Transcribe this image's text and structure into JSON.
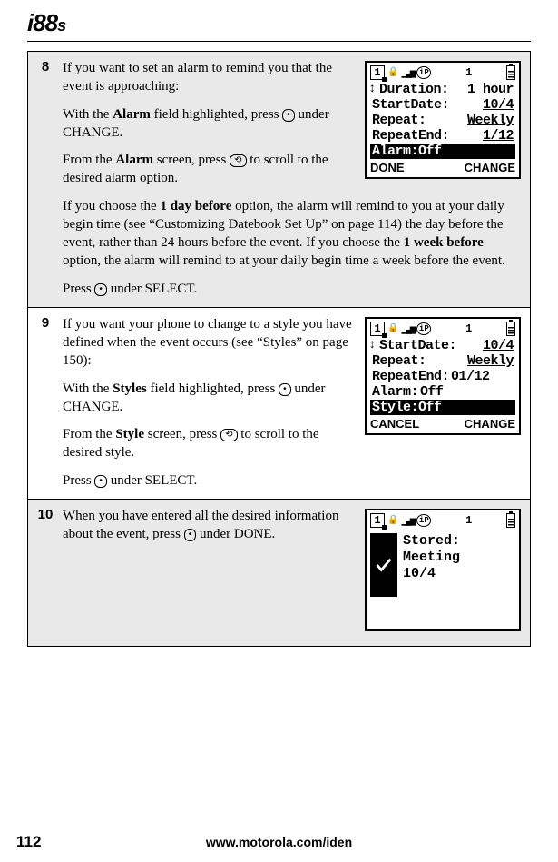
{
  "brand": "i88",
  "brand_suffix": "s",
  "footer_url": "www.motorola.com/iden",
  "page_number": "112",
  "steps": {
    "s8": {
      "num": "8",
      "p1": "If you want to set an alarm to remind you that the event is approaching:",
      "p2a": "With the ",
      "p2b": "Alarm",
      "p2c": " field highlighted, press ",
      "p2d": " under CHANGE.",
      "p3a": "From the ",
      "p3b": "Alarm",
      "p3c": " screen, press ",
      "p3d": " to scroll to the desired alarm option.",
      "p4a": "If you choose the ",
      "p4b": "1 day before",
      "p4c": " option, the alarm will remind to you at your daily begin time (see “Customizing Datebook Set Up” on page 114) the day before the event, rather than 24 hours before the event. If you choose the ",
      "p4d": "1 week before",
      "p4e": " option, the alarm will remind to at your daily begin time a week before the event.",
      "p5a": "Press ",
      "p5b": " under SELECT.",
      "screen": {
        "l1a": "Duration:",
        "l1b": "1 hour",
        "l2a": "StartDate:",
        "l2b": "10/4",
        "l3a": "Repeat:",
        "l3b": "Weekly",
        "l4a": "RepeatEnd:",
        "l4b": "1/12",
        "l5": "Alarm:Off",
        "sk_left": "DONE",
        "sk_right": "CHANGE"
      }
    },
    "s9": {
      "num": "9",
      "p1": "If you want your phone to change to a style you have defined when the event occurs (see “Styles” on page 150):",
      "p2a": "With the ",
      "p2b": "Styles",
      "p2c": " field highlighted, press ",
      "p2d": " under CHANGE.",
      "p3a": "From the ",
      "p3b": "Style",
      "p3c": " screen, press ",
      "p3d": " to scroll to the desired style.",
      "p4a": "Press ",
      "p4b": " under SELECT.",
      "screen": {
        "l1a": "StartDate:",
        "l1b": "10/4",
        "l2a": "Repeat:",
        "l2b": "Weekly",
        "l3a": "RepeatEnd:",
        "l3b": "01/12",
        "l4a": "Alarm:",
        "l4b": "Off",
        "l5": "Style:Off",
        "sk_left": "CANCEL",
        "sk_right": "CHANGE"
      }
    },
    "s10": {
      "num": "10",
      "p1a": "When you have entered all the desired information about the event, press ",
      "p1b": " under DONE.",
      "screen": {
        "t1": "Stored:",
        "t2": "Meeting",
        "t3": "10/4"
      }
    }
  },
  "keys": {
    "soft": "•",
    "scroll": "⟲"
  }
}
